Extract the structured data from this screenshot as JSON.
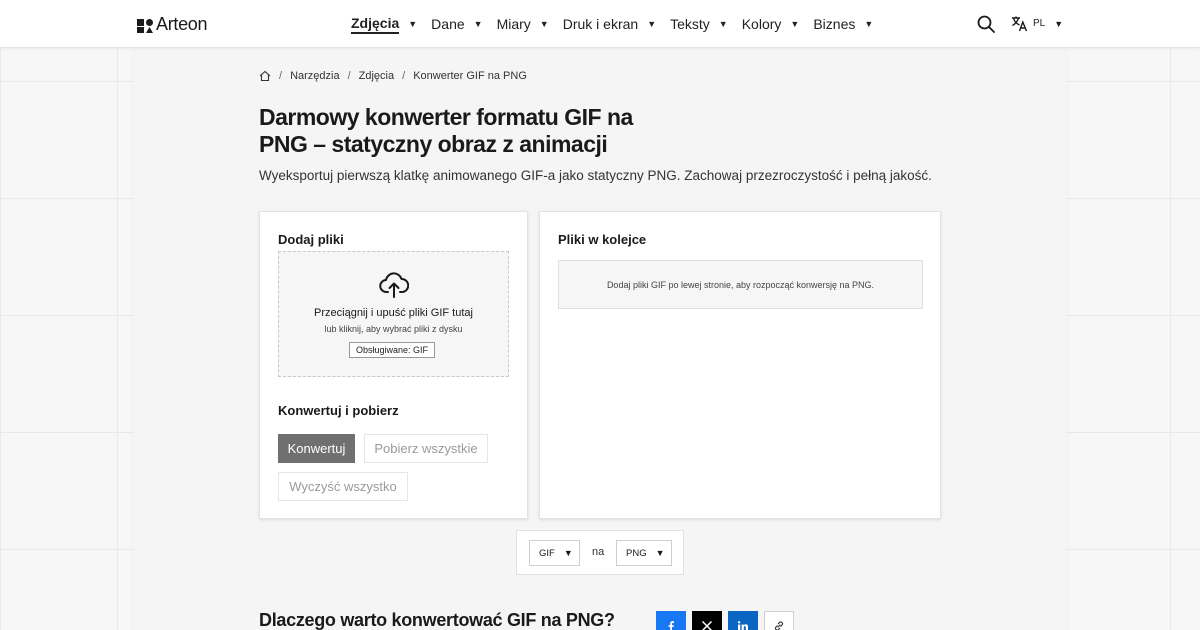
{
  "header": {
    "brand": "Arteon",
    "nav": [
      {
        "label": "Zdjęcia",
        "active": true
      },
      {
        "label": "Dane",
        "active": false
      },
      {
        "label": "Miary",
        "active": false
      },
      {
        "label": "Druk i ekran",
        "active": false
      },
      {
        "label": "Teksty",
        "active": false
      },
      {
        "label": "Kolory",
        "active": false
      },
      {
        "label": "Biznes",
        "active": false
      }
    ],
    "search_icon": "search-icon",
    "language": "PL",
    "language_icon": "translate-icon"
  },
  "breadcrumb": {
    "home_icon": "home-icon",
    "items": [
      "Narzędzia",
      "Zdjęcia",
      "Konwerter GIF na PNG"
    ]
  },
  "page": {
    "title": "Darmowy konwerter formatu GIF na PNG – statyczny obraz z animacji",
    "subtitle": "Wyeksportuj pierwszą klatkę animowanego GIF-a jako statyczny PNG. Zachowaj przezroczystość i pełną jakość."
  },
  "upload": {
    "heading": "Dodaj pliki",
    "icon": "cloud-upload-icon",
    "drop_main": "Przeciągnij i upuść pliki GIF tutaj",
    "drop_sub": "lub kliknij, aby wybrać pliki z dysku",
    "supported": "Obsługiwane: GIF"
  },
  "actions": {
    "heading": "Konwertuj i pobierz",
    "convert": "Konwertuj",
    "download_all": "Pobierz wszystkie",
    "clear_all": "Wyczyść wszystko"
  },
  "queue": {
    "heading": "Pliki w kolejce",
    "empty_text": "Dodaj pliki GIF po lewej stronie, aby rozpocząć konwersję na PNG."
  },
  "format": {
    "from": "GIF",
    "connector": "na",
    "to": "PNG"
  },
  "section": {
    "why_title": "Dlaczego warto konwertować GIF na PNG?"
  },
  "share": [
    "facebook-icon",
    "x-icon",
    "linkedin-icon",
    "link-icon"
  ],
  "colors": {
    "primary_button": "#707070",
    "facebook": "#1877f2",
    "x": "#000000",
    "linkedin": "#0a66c2"
  }
}
